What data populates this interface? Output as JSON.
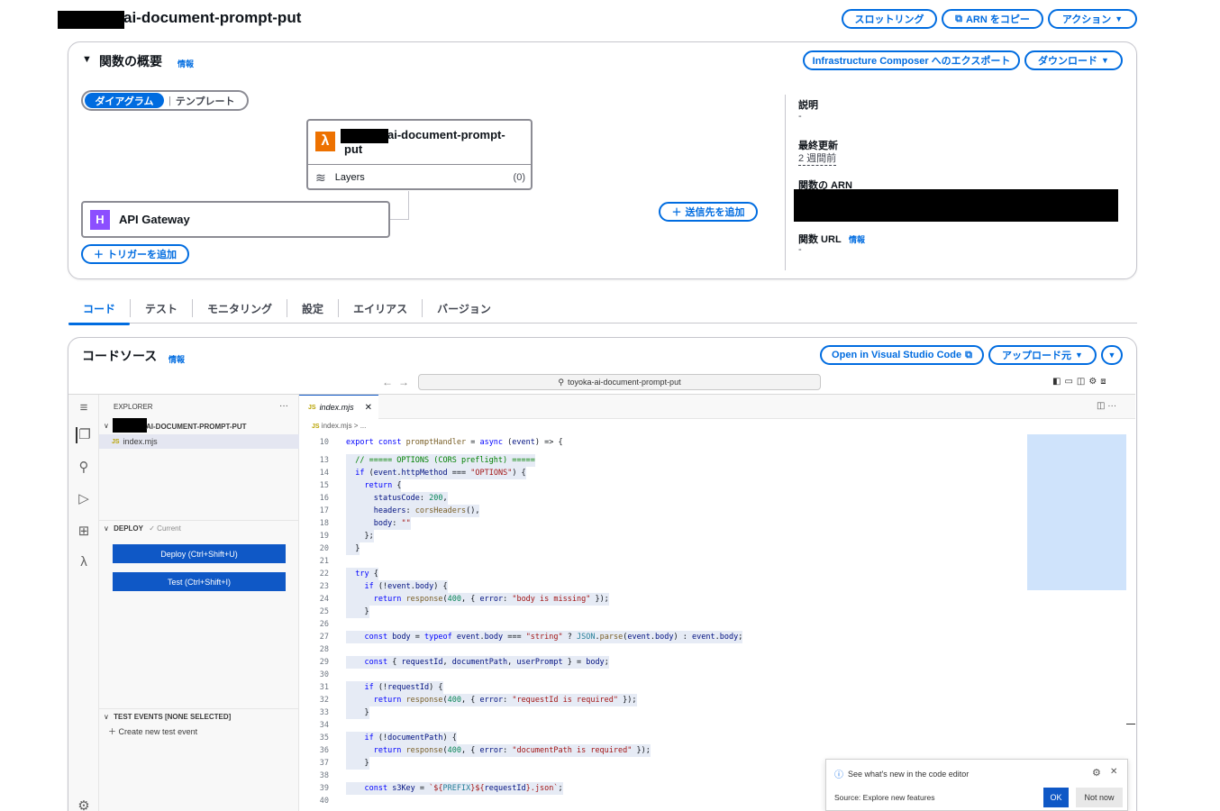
{
  "header": {
    "title_suffix": "ai-document-prompt-put",
    "throttling_btn": "スロットリング",
    "copy_arn_btn": "ARN をコピー",
    "actions_btn": "アクション"
  },
  "overview": {
    "title": "関数の概要",
    "info": "情報",
    "export_btn": "Infrastructure Composer へのエクスポート",
    "download_btn": "ダウンロード",
    "seg_diagram": "ダイアグラム",
    "seg_template": "テンプレート",
    "fn_title": "ai-document-prompt-",
    "fn_title_2": "put",
    "layers_label": "Layers",
    "layers_count": "(0)",
    "apigw_label": "API Gateway",
    "add_trigger": "トリガーを追加",
    "add_destination": "送信先を追加",
    "desc_label": "説明",
    "desc_value": "-",
    "last_modified_label": "最終更新",
    "last_modified_value": "2 週間前",
    "arn_label": "関数の ARN",
    "url_label": "関数 URL",
    "url_info": "情報",
    "url_value": "-"
  },
  "tabs": [
    "コード",
    "テスト",
    "モニタリング",
    "設定",
    "エイリアス",
    "バージョン"
  ],
  "code_source": {
    "title": "コードソース",
    "info": "情報",
    "open_vscode_btn": "Open in Visual Studio Code",
    "upload_btn": "アップロード元",
    "search_text": "toyoka-ai-document-prompt-put"
  },
  "ide": {
    "explorer_label": "EXPLORER",
    "folder_name": "AI-DOCUMENT-PROMPT-PUT",
    "file_name": "index.mjs",
    "deploy_section": "DEPLOY",
    "deploy_current": "✓ Current",
    "deploy_btn": "Deploy (Ctrl+Shift+U)",
    "test_btn": "Test (Ctrl+Shift+I)",
    "test_events_section": "TEST EVENTS [NONE SELECTED]",
    "create_test_event": "Create new test event",
    "editor_tab": "index.mjs",
    "breadcrumb": "index.mjs > ..."
  },
  "notification": {
    "message": "See what's new in the code editor",
    "source": "Source: Explore new features",
    "ok_btn": "OK",
    "not_now_btn": "Not now"
  },
  "colors": {
    "accent": "#006ce0",
    "lambda_orange": "#ed7100",
    "apigw_purple": "#8c4fff",
    "deploy_blue": "#0f58c6"
  }
}
